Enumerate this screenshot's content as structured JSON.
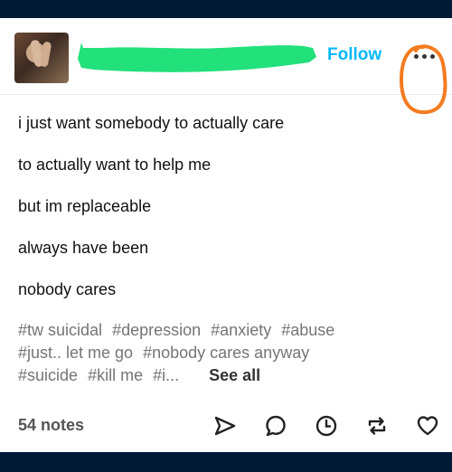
{
  "header": {
    "follow_label": "Follow",
    "more_icon": "more-horizontal-icon",
    "annotation_color": "#f47b20",
    "redaction_color": "#22e07a"
  },
  "post": {
    "lines": [
      "i just want somebody to actually care",
      "to actually want to help me",
      "but im replaceable",
      "always have been",
      "nobody cares"
    ],
    "tags": [
      "#tw suicidal",
      "#depression",
      "#anxiety",
      "#abuse",
      "#just.. let me go",
      "#nobody cares anyway",
      "#suicide",
      "#kill me",
      "#i..."
    ],
    "see_all_label": "See all"
  },
  "footer": {
    "notes_label": "54 notes",
    "icons": [
      "share-icon",
      "reply-icon",
      "history-icon",
      "reblog-icon",
      "like-icon"
    ]
  },
  "colors": {
    "app_bar": "#001935",
    "link": "#00b8ff"
  }
}
